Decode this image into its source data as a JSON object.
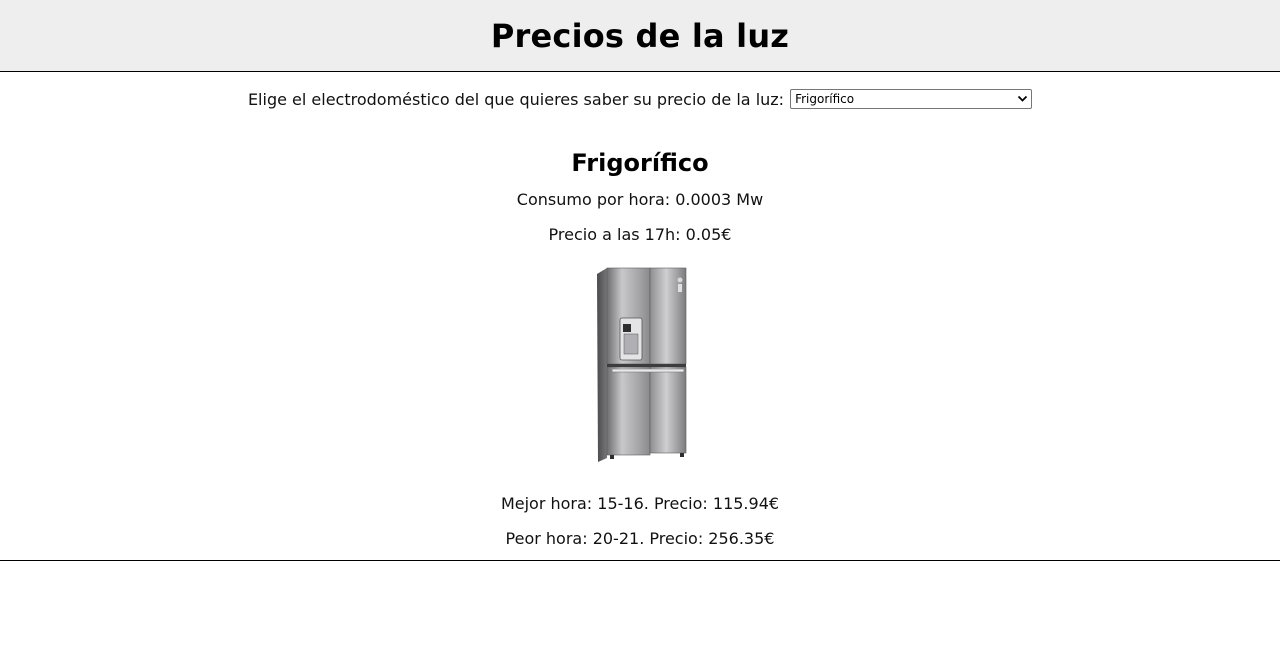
{
  "header": {
    "title": "Precios de la luz"
  },
  "chooser": {
    "label": "Elige el electrodoméstico del que quieres saber su precio de la luz:",
    "selected": "Frigorífico"
  },
  "appliance": {
    "name": "Frigorífico",
    "consumption": "Consumo por hora: 0.0003 Mw",
    "price_now": "Precio a las 17h: 0.05€",
    "image_icon": "refrigerator-image",
    "best_hour": "Mejor hora: 15-16. Precio: 115.94€",
    "worst_hour": "Peor hora: 20-21. Precio: 256.35€"
  },
  "colors": {
    "header_bg": "#eeeeee",
    "text": "#111111"
  }
}
